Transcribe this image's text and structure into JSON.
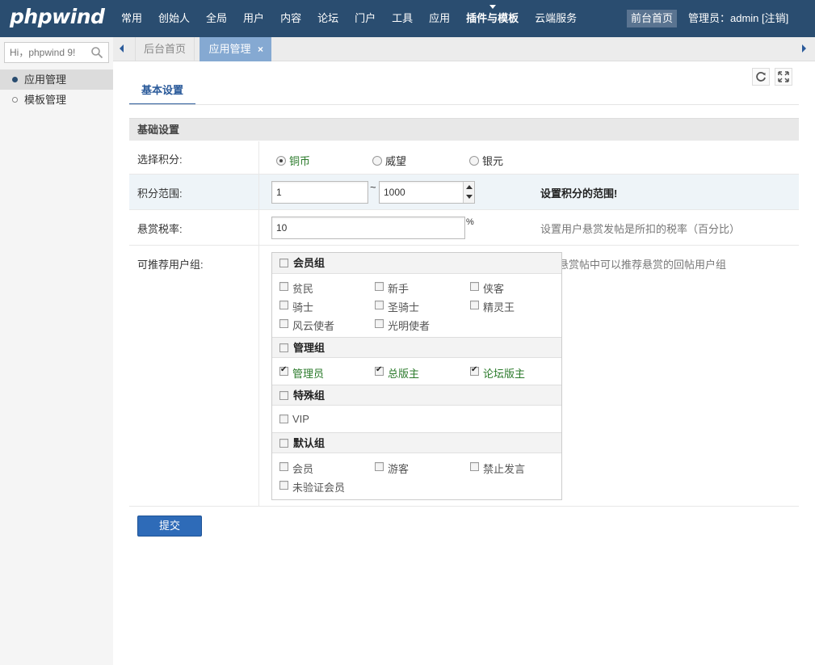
{
  "topbar": {
    "logo": "phpwind",
    "nav": [
      "常用",
      "创始人",
      "全局",
      "用户",
      "内容",
      "论坛",
      "门户",
      "工具",
      "应用",
      "插件与模板",
      "云端服务"
    ],
    "front_label": "前台首页",
    "admin_label": "管理员：admin [注销]"
  },
  "sidebar": {
    "search_placeholder": "Hi，phpwind 9!",
    "items": [
      {
        "label": "应用管理"
      },
      {
        "label": "模板管理"
      }
    ]
  },
  "tabs": {
    "home": "后台首页",
    "current": "应用管理",
    "close": "×"
  },
  "main": {
    "sub_tab": "基本设置",
    "section_title": "基础设置",
    "credit": {
      "label": "选择积分:",
      "options": [
        "铜币",
        "威望",
        "银元"
      ],
      "selected": "铜币"
    },
    "range": {
      "label": "积分范围:",
      "min": "1",
      "sep": "~",
      "max": "1000",
      "hint": "设置积分的范围!"
    },
    "tax": {
      "label": "悬赏税率:",
      "value": "10",
      "unit": "%",
      "hint": "设置用户悬赏发帖是所扣的税率（百分比）"
    },
    "groups": {
      "label": "可推荐用户组:",
      "hint": "在悬赏帖中可以推荐悬赏的回帖用户组",
      "member": {
        "title": "会员组",
        "items": [
          "贫民",
          "新手",
          "侠客",
          "骑士",
          "圣骑士",
          "精灵王",
          "风云使者",
          "光明使者"
        ]
      },
      "admin": {
        "title": "管理组",
        "items": [
          "管理员",
          "总版主",
          "论坛版主"
        ]
      },
      "special": {
        "title": "特殊组",
        "items": [
          "VIP"
        ]
      },
      "default": {
        "title": "默认组",
        "items": [
          "会员",
          "游客",
          "禁止发言",
          "未验证会员"
        ]
      }
    },
    "submit": "提交"
  }
}
